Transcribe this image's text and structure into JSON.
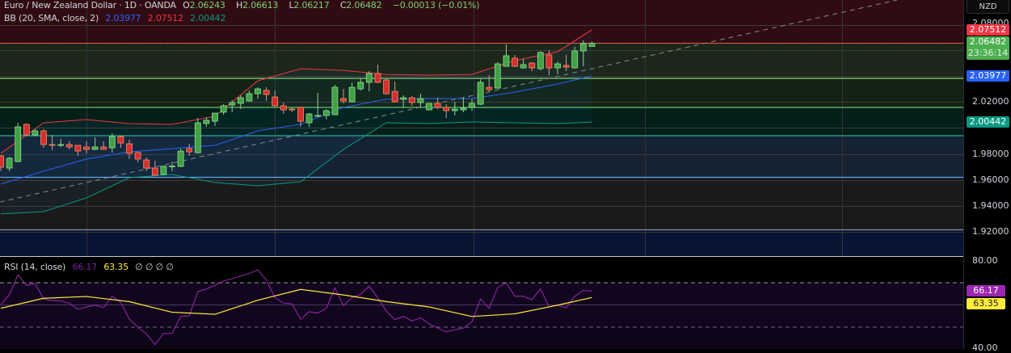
{
  "header": {
    "symbol": "Euro / New Zealand Dollar · 1D · OANDA",
    "open_label": "O",
    "open": "2.06243",
    "high_label": "H",
    "high": "2.06613",
    "low_label": "L",
    "low": "2.06217",
    "close_label": "C",
    "close": "2.06482",
    "change": "−0.00013 (−0.01%)"
  },
  "bb_legend": {
    "label": "BB (20, SMA, close, 2)",
    "basis": "2.03977",
    "upper": "2.07512",
    "lower": "2.00442"
  },
  "rsi_legend": {
    "label": "RSI (14, close)",
    "rsi": "66.17",
    "ma": "63.35",
    "empty": "∅ ∅ ∅ ∅"
  },
  "price_axis": {
    "currency": "NZD",
    "ticks": [
      "2.08000",
      "2.02000",
      "1.98000",
      "1.96000",
      "1.94000",
      "1.92000"
    ],
    "tags": {
      "bb_upper": "2.07512",
      "last_price": "2.06482",
      "countdown": "23:36:14",
      "bb_basis": "2.03977",
      "bb_lower": "2.00442"
    }
  },
  "rsi_axis": {
    "ticks": [
      "80.00",
      "40.00"
    ],
    "tags": {
      "rsi": "66.17",
      "ma": "63.35"
    }
  },
  "colors": {
    "up": "#43a047",
    "down": "#d32f2f",
    "bb_upper": "#f23645",
    "bb_basis": "#2962ff",
    "bb_lower": "#089981",
    "rsi": "#9c27b0",
    "rsi_ma": "#ffeb3b",
    "last_price": "#4caf50"
  },
  "chart_data": [
    {
      "type": "candlestick",
      "title": "Euro / New Zealand Dollar · 1D · OANDA",
      "ylim": [
        1.905,
        2.09
      ],
      "grid": true,
      "ohlc_fields": [
        "open",
        "high",
        "low",
        "close"
      ],
      "candles": [
        [
          1.9785,
          1.9791,
          1.9668,
          1.9699
        ],
        [
          1.9692,
          1.9779,
          1.9668,
          1.9767
        ],
        [
          1.9742,
          2.0039,
          1.9736,
          2.0008
        ],
        [
          2.0027,
          2.0033,
          1.994,
          1.9946
        ],
        [
          1.9946,
          1.999,
          1.9934,
          1.9977
        ],
        [
          1.9977,
          1.999,
          1.9847,
          1.9872
        ],
        [
          1.9872,
          1.9946,
          1.9829,
          1.9869
        ],
        [
          1.9869,
          1.9915,
          1.9853,
          1.9872
        ],
        [
          1.9872,
          1.9897,
          1.9835,
          1.9853
        ],
        [
          1.9866,
          1.9866,
          1.9785,
          1.9822
        ],
        [
          1.9853,
          1.9897,
          1.9804,
          1.9835
        ],
        [
          1.9835,
          1.9928,
          1.9829,
          1.9853
        ],
        [
          1.9853,
          1.9897,
          1.9835,
          1.9835
        ],
        [
          1.9847,
          1.9959,
          1.981,
          1.9934
        ],
        [
          1.9934,
          1.994,
          1.9847,
          1.9884
        ],
        [
          1.9878,
          1.9909,
          1.9761,
          1.9804
        ],
        [
          1.981,
          1.9822,
          1.9736,
          1.9761
        ],
        [
          1.9754,
          1.9773,
          1.9668,
          1.9692
        ],
        [
          1.9692,
          1.9748,
          1.9637,
          1.9637
        ],
        [
          1.9643,
          1.9711,
          1.9637,
          1.9705
        ],
        [
          1.9702,
          1.9742,
          1.9668,
          1.9708
        ],
        [
          1.9705,
          1.9841,
          1.9699,
          1.9822
        ],
        [
          1.9841,
          1.9878,
          1.9785,
          1.9816
        ],
        [
          1.981,
          2.0076,
          1.9804,
          2.0039
        ],
        [
          2.0033,
          2.0082,
          2.0008,
          2.0058
        ],
        [
          2.0051,
          2.0113,
          2.0014,
          2.0113
        ],
        [
          2.012,
          2.0181,
          2.0101,
          2.0169
        ],
        [
          2.0175,
          2.0212,
          2.012,
          2.0194
        ],
        [
          2.0188,
          2.025,
          2.0144,
          2.0231
        ],
        [
          2.0206,
          2.0287,
          2.02,
          2.0262
        ],
        [
          2.0262,
          2.0311,
          2.0225,
          2.0299
        ],
        [
          2.0287,
          2.0311,
          2.0206,
          2.0256
        ],
        [
          2.0237,
          2.0287,
          2.0163,
          2.0169
        ],
        [
          2.0169,
          2.0194,
          2.0107,
          2.0138
        ],
        [
          2.0144,
          2.0157,
          2.012,
          2.0141
        ],
        [
          2.0157,
          2.0163,
          2.0008,
          2.0051
        ],
        [
          2.0039,
          2.0113,
          2.0008,
          2.0107
        ],
        [
          2.0092,
          2.0268,
          2.0082,
          2.0095
        ],
        [
          2.0095,
          2.0144,
          2.0064,
          2.0132
        ],
        [
          2.0101,
          2.033,
          2.0101,
          2.0311
        ],
        [
          2.0225,
          2.0299,
          2.0188,
          2.0206
        ],
        [
          2.02,
          2.0349,
          2.0194,
          2.0311
        ],
        [
          2.0299,
          2.038,
          2.0287,
          2.0349
        ],
        [
          2.0349,
          2.0435,
          2.028,
          2.0417
        ],
        [
          2.0417,
          2.0485,
          2.0342,
          2.0349
        ],
        [
          2.0367,
          2.038,
          2.0256,
          2.0262
        ],
        [
          2.028,
          2.0355,
          2.0194,
          2.02
        ],
        [
          2.0219,
          2.025,
          2.0157,
          2.0231
        ],
        [
          2.0231,
          2.0243,
          2.0169,
          2.0194
        ],
        [
          2.0194,
          2.0262,
          2.0157,
          2.0225
        ],
        [
          2.0138,
          2.0188,
          2.0138,
          2.0188
        ],
        [
          2.0188,
          2.0231,
          2.0144,
          2.0157
        ],
        [
          2.0157,
          2.0181,
          2.0076,
          2.0132
        ],
        [
          2.0132,
          2.02,
          2.0095,
          2.0144
        ],
        [
          2.0138,
          2.0231,
          2.012,
          2.015
        ],
        [
          2.0157,
          2.0219,
          2.0132,
          2.0188
        ],
        [
          2.0181,
          2.0373,
          2.0175,
          2.0349
        ],
        [
          2.0311,
          2.0404,
          2.028,
          2.0293
        ],
        [
          2.0305,
          2.0503,
          2.0299,
          2.0491
        ],
        [
          2.0472,
          2.064,
          2.0472,
          2.0553
        ],
        [
          2.0534,
          2.0559,
          2.0466,
          2.0472
        ],
        [
          2.046,
          2.0528,
          2.0454,
          2.0485
        ],
        [
          2.0497,
          2.0503,
          2.0435,
          2.046
        ],
        [
          2.0454,
          2.059,
          2.0441,
          2.0578
        ],
        [
          2.0559,
          2.0596,
          2.0404,
          2.046
        ],
        [
          2.046,
          2.0509,
          2.041,
          2.0491
        ],
        [
          2.0479,
          2.0559,
          2.0435,
          2.0466
        ],
        [
          2.046,
          2.0621,
          2.0454,
          2.059
        ],
        [
          2.059,
          2.067,
          2.0472,
          2.0646
        ],
        [
          2.06243,
          2.06613,
          2.06217,
          2.06482
        ]
      ],
      "bollinger": {
        "sample_every_n_candles": 5,
        "upper": [
          1.9804,
          2.0039,
          2.0064,
          2.0033,
          2.0027,
          2.0089,
          2.0361,
          2.0454,
          2.0441,
          2.041,
          2.0404,
          2.041,
          2.0516,
          2.0584,
          2.07512
        ],
        "basis": [
          1.9569,
          1.9668,
          1.9761,
          1.9816,
          1.9841,
          1.9866,
          1.9977,
          2.0027,
          2.0157,
          2.0219,
          2.0225,
          2.0225,
          2.0274,
          2.0336,
          2.03977
        ],
        "lower": [
          1.934,
          1.9358,
          1.9463,
          1.9618,
          1.9643,
          1.9581,
          1.9556,
          1.9587,
          1.9835,
          2.0039,
          2.0033,
          2.0045,
          2.0039,
          2.0033,
          2.00442
        ]
      }
    },
    {
      "type": "line",
      "title": "RSI (14, close)",
      "ylim": [
        38,
        80.5
      ],
      "series": [
        {
          "values": [
            60.3,
            64.5,
            73.6,
            68.8,
            69.6,
            62.7,
            61.9,
            61.9,
            60.7,
            58.1,
            59.1,
            59.9,
            58.8,
            63.9,
            61.2,
            53.6,
            50.0,
            47.0,
            42.1,
            47.2,
            47.2,
            54.8,
            55.1,
            66.0,
            67.2,
            68.8,
            70.8,
            71.8,
            73.0,
            74.2,
            75.8,
            71.2,
            63.3,
            60.9,
            60.5,
            53.6,
            57.0,
            56.3,
            58.5,
            67.6,
            59.7,
            63.3,
            64.8,
            68.4,
            63.3,
            57.3,
            53.4,
            54.8,
            52.8,
            54.2,
            51.5,
            49.6,
            47.9,
            48.8,
            49.6,
            52.4,
            62.7,
            58.5,
            67.8,
            70.0,
            63.9,
            63.9,
            62.4,
            67.2,
            59.1,
            59.9,
            58.7,
            63.9,
            66.6,
            66.17
          ]
        },
        {
          "sample_every_n_candles": 5,
          "values": [
            58.5,
            63.0,
            63.8,
            61.5,
            56.7,
            55.8,
            62.1,
            67.0,
            64.5,
            61.5,
            59.1,
            54.8,
            56.0,
            59.9,
            63.35
          ]
        }
      ]
    }
  ]
}
